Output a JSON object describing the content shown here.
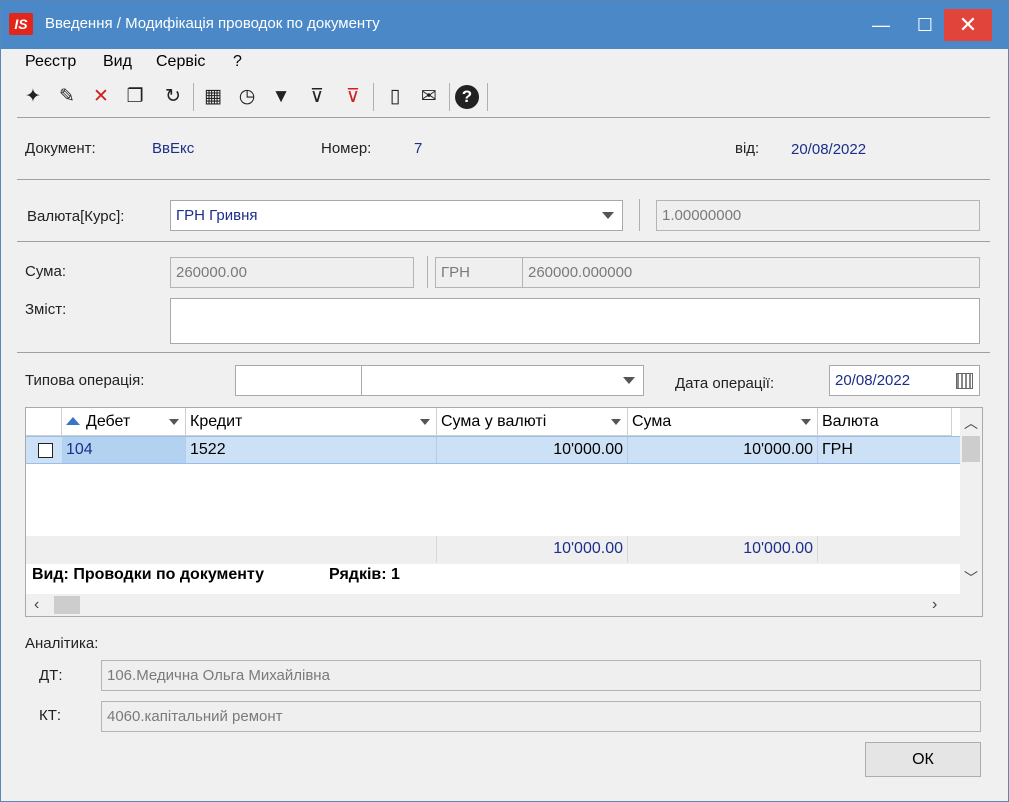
{
  "window": {
    "logo": "IS",
    "title": "Введення / Модифікація проводок по документу",
    "minimize": "—",
    "maximize": "☐",
    "close": "✕"
  },
  "menu": [
    "Реєстр",
    "Вид",
    "Сервіс",
    "?"
  ],
  "toolbar": {
    "icons": [
      "new-icon",
      "edit-icon",
      "delete-icon",
      "copy-icon",
      "refresh-icon",
      "table-icon",
      "clock-icon",
      "filter-icon",
      "filter-apply-icon",
      "filter-clear-icon",
      "form-icon",
      "email-icon",
      "help-icon"
    ]
  },
  "document": {
    "doc_label": "Документ:",
    "doc_value": "ВвЕкс",
    "number_label": "Номер:",
    "number_value": "7",
    "date_label": "від:",
    "date_value": "20/08/2022"
  },
  "currency": {
    "label": "Валюта[Курс]:",
    "value": "ГРН Гривня",
    "rate": "1.00000000"
  },
  "sum": {
    "label": "Сума:",
    "value": "260000.00",
    "currency": "ГРН",
    "currency_value": "260000.000000"
  },
  "content": {
    "label": "Зміст:",
    "value": ""
  },
  "operation": {
    "label": "Типова операція:",
    "code": "",
    "name": "",
    "date_label": "Дата операції:",
    "date_value": "20/08/2022"
  },
  "grid": {
    "columns": [
      "Дебет",
      "Кредит",
      "Сума у валюті",
      "Сума",
      "Валюта"
    ],
    "rows": [
      {
        "debit": "104",
        "credit": "1522",
        "sum_currency": "10'000.00",
        "sum": "10'000.00",
        "currency": "ГРН"
      }
    ],
    "totals": {
      "sum_currency": "10'000.00",
      "sum": "10'000.00"
    },
    "view_label": "Вид: Проводки по документу",
    "rows_label": "Рядків: 1"
  },
  "analytics": {
    "label": "Аналітика:",
    "dt_label": "ДТ:",
    "dt_value": "106.Медична Ольга Михайлівна",
    "kt_label": "КТ:",
    "kt_value": "4060.капітальний ремонт"
  },
  "buttons": {
    "ok": "ОК"
  }
}
